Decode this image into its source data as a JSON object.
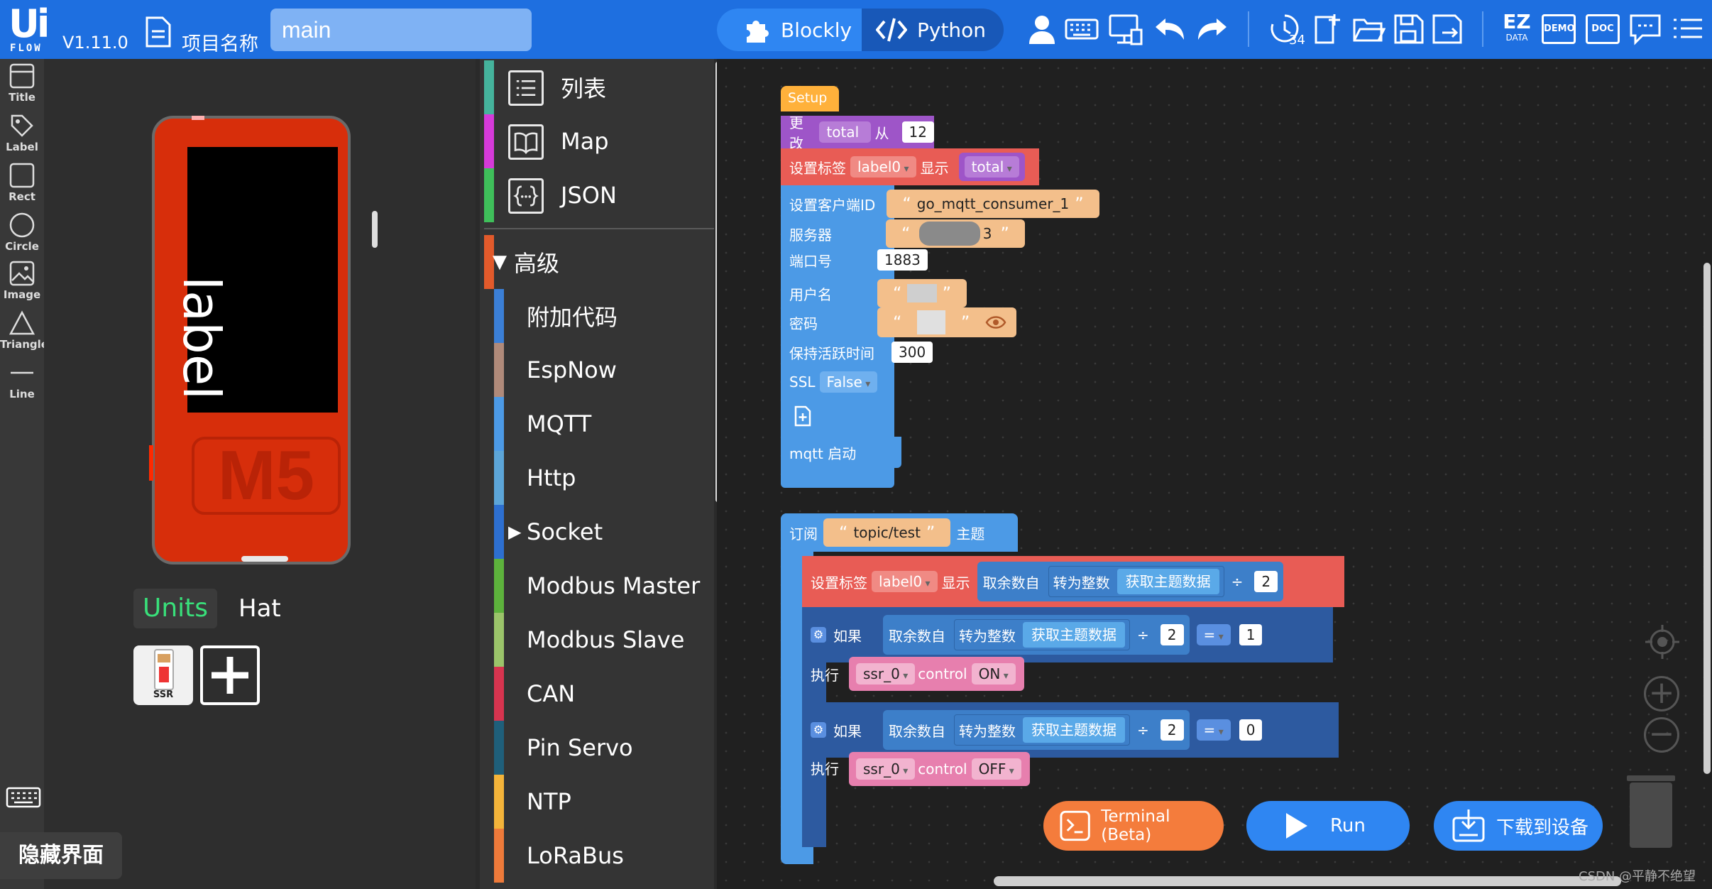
{
  "header": {
    "logo_ui": "Ui",
    "logo_flow": "FLOW",
    "version": "V1.11.0",
    "project_label": "项目名称",
    "project_name": "main",
    "mode_blockly": "Blockly",
    "mode_python": "Python",
    "history_count": "34",
    "ez_data": "EZ",
    "ez_data_sub": "DATA",
    "demo": "DEMO",
    "doc": "DOC"
  },
  "tools": [
    {
      "label": "Title"
    },
    {
      "label": "Label"
    },
    {
      "label": "Rect"
    },
    {
      "label": "Circle"
    },
    {
      "label": "Image"
    },
    {
      "label": "Triangle"
    },
    {
      "label": "Line"
    }
  ],
  "preview": {
    "screen_label": "label",
    "device_logo": "M5",
    "tab_units": "Units",
    "tab_hat": "Hat",
    "unit_name": "SSR",
    "hide_ui": "隐藏界面"
  },
  "categories": {
    "top": [
      "列表",
      "Map",
      "JSON"
    ],
    "advanced": "高级",
    "items": [
      "附加代码",
      "EspNow",
      "MQTT",
      "Http",
      "Socket",
      "Modbus Master",
      "Modbus Slave",
      "CAN",
      "Pin Servo",
      "NTP",
      "LoRaBus"
    ]
  },
  "workspace": {
    "setup": "Setup",
    "set_var": "更改",
    "var_total": "total",
    "from": "从",
    "val_12": "12",
    "set_label": "设置标签",
    "label0": "label0",
    "show": "显示",
    "client_id": "设置客户端ID",
    "client_id_value": "go_mqtt_consumer_1",
    "server": "服务器",
    "server_tail": "3",
    "port": "端口号",
    "port_value": "1883",
    "username": "用户名",
    "password": "密码",
    "keepalive": "保持活跃时间",
    "keepalive_value": "300",
    "ssl": "SSL",
    "ssl_value": "False",
    "mqtt_start": "mqtt 启动",
    "subscribe": "订阅",
    "topic": "topic/test",
    "topic_word": "主题",
    "mod": "取余数自",
    "to_int": "转为整数",
    "get_topic": "获取主题数据",
    "div": "÷",
    "two": "2",
    "if": "如果",
    "do": "执行",
    "eq": "=",
    "one": "1",
    "zero": "0",
    "ssr": "ssr_0",
    "control": "control",
    "on": "ON",
    "off": "OFF"
  },
  "buttons": {
    "terminal": "Terminal (Beta)",
    "run": "Run",
    "download": "下载到设备"
  },
  "watermark": "CSDN @平静不绝望",
  "colors": {
    "topbar": "#1e6fe0",
    "setup": "#ffb13b",
    "variable": "#9e55c8",
    "label_block": "#e85c55",
    "mqtt": "#4c9ae6",
    "math": "#3d7fc9",
    "logic": "#2d5aa0",
    "ssr": "#e77fae",
    "string": "#f3bf8b"
  }
}
